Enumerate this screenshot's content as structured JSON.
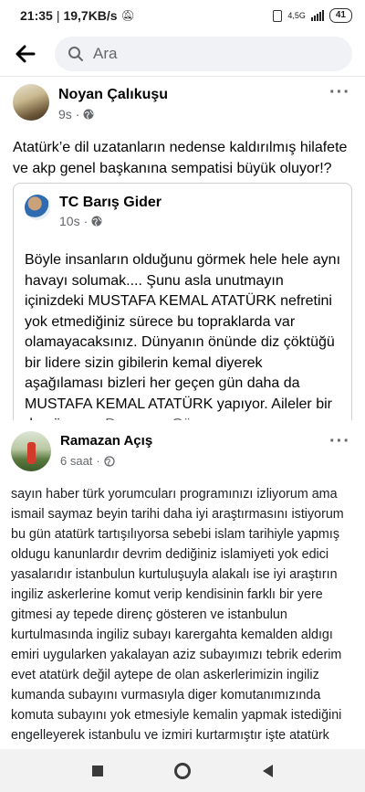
{
  "status_bar": {
    "time": "21:35",
    "network_speed": "19,7KB/s",
    "network_type": "4,5G",
    "battery": "41"
  },
  "search": {
    "placeholder": "Ara"
  },
  "post_main": {
    "author": "Noyan Çalıkuşu",
    "time": "9s",
    "text": "Atatürk’e dil uzatanların nedense kaldırılmış hilafete ve akp genel başkanına sempatisi büyük oluyor!?",
    "shared": {
      "author": "TC Barış Gider",
      "time": "10s",
      "text": "Böyle insanların olduğunu görmek hele hele aynı havayı solumak.... Şunu asla unutmayın içinizdeki MUSTAFA KEMAL ATATÜRK nefretini yok etmediğiniz sürece bu topraklarda var olamayacaksınız. Dünyanın önünde diz çöktüğü bir lidere sizin gibilerin kemal diyerek aşağılaması bizleri her geçen gün daha da MUSTAFA KEMAL ATATÜRK yapıyor. Aileler bir de güven…",
      "see_more": "Devamını Gör"
    }
  },
  "post_screenshot": {
    "author": "Ramazan Açış",
    "time": "6 saat",
    "text": "sayın haber türk yorumcuları programınızı izliyorum ama ismail saymaz beyin tarihi daha iyi araştırmasını istiyorum bu gün atatürk tartışılıyorsa sebebi islam tarihiyle yapmış oldugu kanunlardır devrim dediğiniz islamiyeti yok edici yasalarıdır istanbulun kurtuluşuyla alakalı ise iyi araştırın ingiliz askerlerine komut verip kendisinin farklı bir yere gitmesi ay tepede direnç gösteren ve istanbulun kurtulmasında ingiliz subayı karergahta kemalden aldıgı emiri uygularken yakalayan aziz subayımızı tebrik ederim evet atatürk değil aytepe de olan askerlerimizin ingiliz kumanda subayını vurmasıyla diger komutanımızında komuta subayını yok etmesiyle kemalin yapmak istediğini engelleyerek istanbulu ve izmiri kurtarmıştır işte atatürk dediğiniz kişinin yaptıkları araştırın ali erbaş hocamız dogrusunu yapmıştır ismail saymaz  osmanlıdan öncesi ve sonrası"
  },
  "icons": {
    "back": "arrow-left-icon",
    "search": "search-icon",
    "globe": "globe-icon",
    "more": "more-horizontal-icon",
    "nav_square": "recent-apps-icon",
    "nav_circle": "home-icon",
    "nav_triangle": "back-triangle-icon"
  },
  "colors": {
    "link": "#65676b",
    "text": "#050505",
    "secondary": "#65676b",
    "search_bg": "#f0f2f5"
  }
}
